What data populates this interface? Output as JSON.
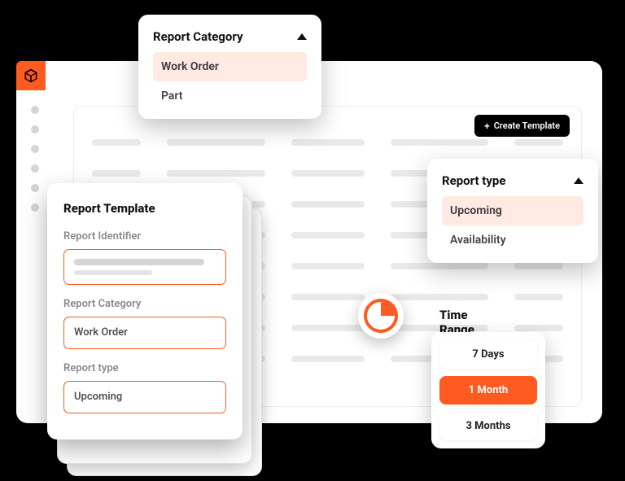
{
  "colors": {
    "accent": "#ff5a1f",
    "dark": "#000000"
  },
  "app": {
    "create_button_label": "Create Template"
  },
  "dropdowns": {
    "category": {
      "title": "Report Category",
      "options": [
        "Work Order",
        "Part"
      ],
      "selected": "Work Order"
    },
    "type": {
      "title": "Report type",
      "options": [
        "Upcoming",
        "Availability"
      ],
      "selected": "Upcoming"
    }
  },
  "template": {
    "panel_title": "Report Template",
    "fields": {
      "identifier_label": "Report Identifier",
      "category_label": "Report Category",
      "category_value": "Work Order",
      "type_label": "Report type",
      "type_value": "Upcoming"
    }
  },
  "time_range": {
    "title": "Time Range",
    "options": [
      "7 Days",
      "1 Month",
      "3 Months"
    ],
    "selected": "1 Month"
  }
}
